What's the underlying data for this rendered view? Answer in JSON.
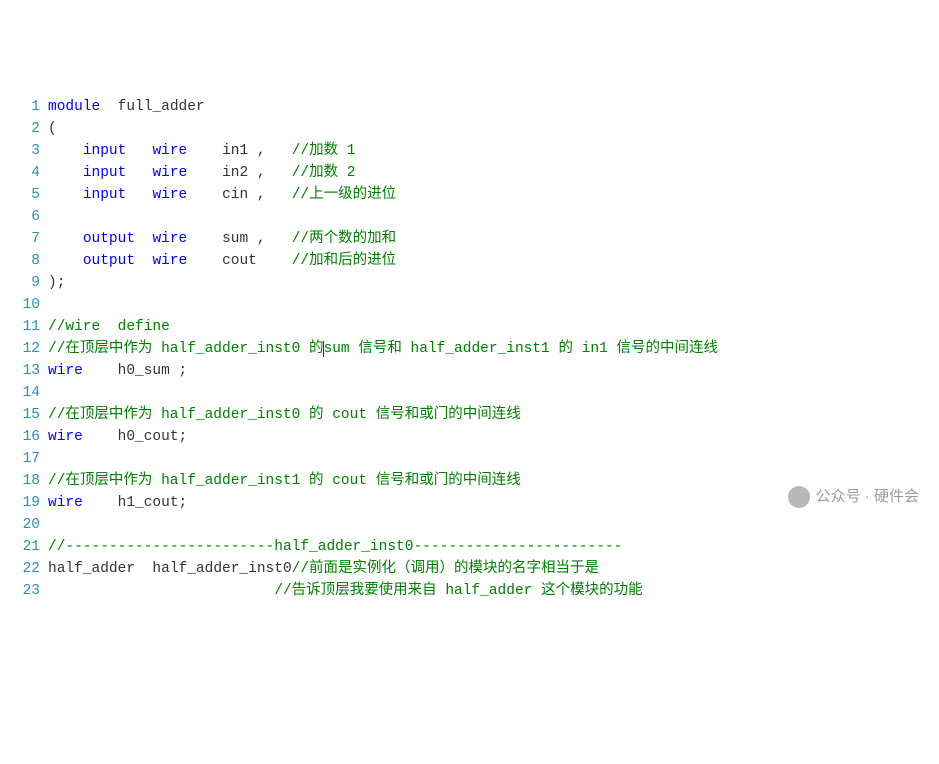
{
  "lines": [
    {
      "n": 1,
      "tokens": [
        {
          "t": "module",
          "c": "kw"
        },
        {
          "t": "  "
        },
        {
          "t": "full_adder",
          "c": "ident"
        }
      ]
    },
    {
      "n": 2,
      "tokens": [
        {
          "t": "(",
          "c": "punc"
        }
      ]
    },
    {
      "n": 3,
      "tokens": [
        {
          "t": "    "
        },
        {
          "t": "input",
          "c": "kw"
        },
        {
          "t": "   "
        },
        {
          "t": "wire",
          "c": "type"
        },
        {
          "t": "    "
        },
        {
          "t": "in1",
          "c": "ident"
        },
        {
          "t": " ,   "
        },
        {
          "t": "//加数 1",
          "c": "cmt"
        }
      ]
    },
    {
      "n": 4,
      "tokens": [
        {
          "t": "    "
        },
        {
          "t": "input",
          "c": "kw"
        },
        {
          "t": "   "
        },
        {
          "t": "wire",
          "c": "type"
        },
        {
          "t": "    "
        },
        {
          "t": "in2",
          "c": "ident"
        },
        {
          "t": " ,   "
        },
        {
          "t": "//加数 2",
          "c": "cmt"
        }
      ]
    },
    {
      "n": 5,
      "tokens": [
        {
          "t": "    "
        },
        {
          "t": "input",
          "c": "kw"
        },
        {
          "t": "   "
        },
        {
          "t": "wire",
          "c": "type"
        },
        {
          "t": "    "
        },
        {
          "t": "cin",
          "c": "ident"
        },
        {
          "t": " ,   "
        },
        {
          "t": "//上一级的进位",
          "c": "cmt"
        }
      ]
    },
    {
      "n": 6,
      "tokens": []
    },
    {
      "n": 7,
      "tokens": [
        {
          "t": "    "
        },
        {
          "t": "output",
          "c": "kw"
        },
        {
          "t": "  "
        },
        {
          "t": "wire",
          "c": "type"
        },
        {
          "t": "    "
        },
        {
          "t": "sum",
          "c": "ident"
        },
        {
          "t": " ,   "
        },
        {
          "t": "//两个数的加和",
          "c": "cmt"
        }
      ]
    },
    {
      "n": 8,
      "tokens": [
        {
          "t": "    "
        },
        {
          "t": "output",
          "c": "kw"
        },
        {
          "t": "  "
        },
        {
          "t": "wire",
          "c": "type"
        },
        {
          "t": "    "
        },
        {
          "t": "cout",
          "c": "ident"
        },
        {
          "t": "    "
        },
        {
          "t": "//加和后的进位",
          "c": "cmt"
        }
      ]
    },
    {
      "n": 9,
      "tokens": [
        {
          "t": ");",
          "c": "punc"
        }
      ]
    },
    {
      "n": 10,
      "tokens": []
    },
    {
      "n": 11,
      "tokens": [
        {
          "t": "//wire  define",
          "c": "cmt"
        }
      ]
    },
    {
      "n": 12,
      "tokens": [
        {
          "t": "//在顶层中作为 half_adder_inst0 的",
          "c": "cmt"
        },
        {
          "caret": true
        },
        {
          "t": "sum 信号和 half_adder_inst1 的 in1 信号的中间连线",
          "c": "cmt"
        }
      ]
    },
    {
      "n": 13,
      "tokens": [
        {
          "t": "wire",
          "c": "type"
        },
        {
          "t": "    "
        },
        {
          "t": "h0_sum",
          "c": "ident"
        },
        {
          "t": " ;",
          "c": "punc"
        }
      ]
    },
    {
      "n": 14,
      "tokens": []
    },
    {
      "n": 15,
      "tokens": [
        {
          "t": "//在顶层中作为 half_adder_inst0 的 cout 信号和或门的中间连线",
          "c": "cmt"
        }
      ]
    },
    {
      "n": 16,
      "tokens": [
        {
          "t": "wire",
          "c": "type"
        },
        {
          "t": "    "
        },
        {
          "t": "h0_cout",
          "c": "ident"
        },
        {
          "t": ";",
          "c": "punc"
        }
      ]
    },
    {
      "n": 17,
      "tokens": []
    },
    {
      "n": 18,
      "tokens": [
        {
          "t": "//在顶层中作为 half_adder_inst1 的 cout 信号和或门的中间连线",
          "c": "cmt"
        }
      ]
    },
    {
      "n": 19,
      "tokens": [
        {
          "t": "wire",
          "c": "type"
        },
        {
          "t": "    "
        },
        {
          "t": "h1_cout",
          "c": "ident"
        },
        {
          "t": ";",
          "c": "punc"
        }
      ]
    },
    {
      "n": 20,
      "tokens": []
    },
    {
      "n": 21,
      "tokens": [
        {
          "t": "//------------------------half_adder_inst0------------------------",
          "c": "cmt"
        }
      ]
    },
    {
      "n": 22,
      "tokens": [
        {
          "t": "half_adder",
          "c": "ident"
        },
        {
          "t": "  "
        },
        {
          "t": "half_adder_inst0",
          "c": "ident"
        },
        {
          "t": "//前面是实例化（调用）的模块的名字相当于是",
          "c": "cmt"
        }
      ]
    },
    {
      "n": 23,
      "tokens": [
        {
          "t": "                          "
        },
        {
          "t": "//告诉顶层我要使用来自 half_adder 这个模块的功能",
          "c": "cmt"
        }
      ]
    }
  ],
  "watermark": {
    "text": "公众号 · 硬件会"
  }
}
